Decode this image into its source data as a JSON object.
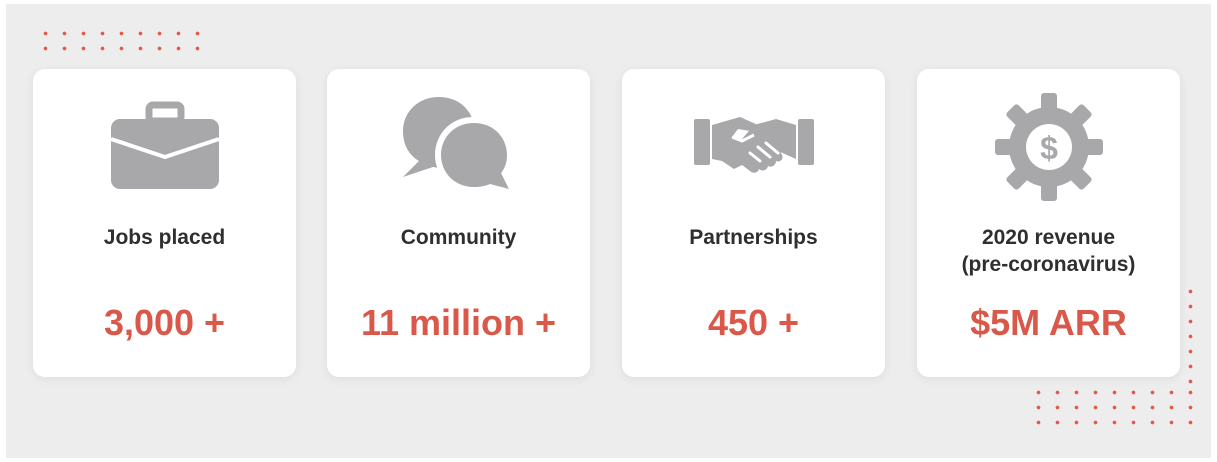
{
  "colors": {
    "background_panel": "#ededee",
    "card": "#ffffff",
    "accent": "#d9584a",
    "dots": "#e25a45",
    "icon": "#a8a8ab",
    "label_text": "#2f2f2f"
  },
  "stats": [
    {
      "icon": "briefcase-icon",
      "label": "Jobs placed",
      "value": "3,000 +"
    },
    {
      "icon": "speech-bubbles-icon",
      "label": "Community",
      "value": "11 million +"
    },
    {
      "icon": "handshake-icon",
      "label": "Partnerships",
      "value": "450 +"
    },
    {
      "icon": "dollar-gear-icon",
      "label": "2020 revenue\n(pre-coronavirus)",
      "value": "$5M ARR"
    }
  ]
}
